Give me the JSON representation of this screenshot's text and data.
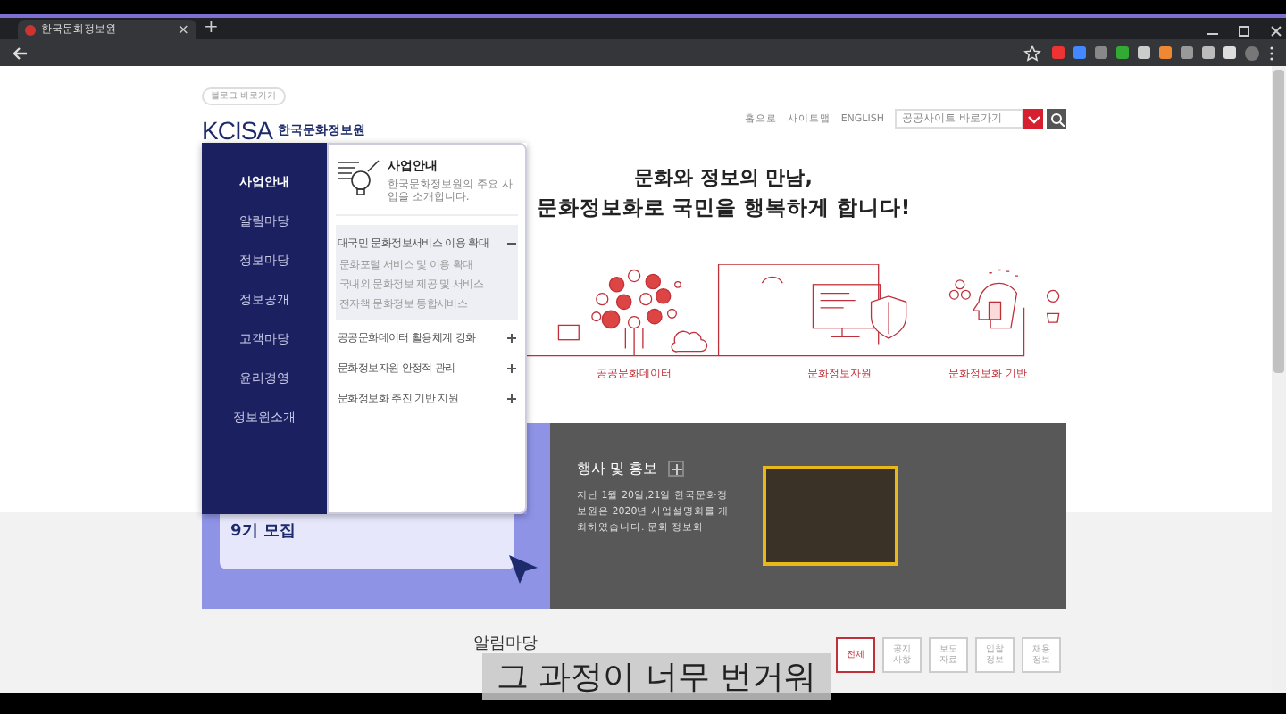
{
  "browser": {
    "tab_title": "한국문화정보원",
    "tab_close": "×",
    "new_tab": "+"
  },
  "header": {
    "quick_link": "블로그 바로가기",
    "logo": "KCISA",
    "logo_sub": "한국문화정보원",
    "util_links": [
      "홈으로",
      "사이트맵",
      "ENGLISH"
    ],
    "site_select": {
      "placeholder": "공공사이트 바로가기"
    }
  },
  "nav": {
    "items": [
      {
        "label": "사업안내",
        "selected": true
      },
      {
        "label": "알림마당",
        "selected": false
      },
      {
        "label": "정보마당",
        "selected": false
      },
      {
        "label": "정보공개",
        "selected": false
      },
      {
        "label": "고객마당",
        "selected": false
      },
      {
        "label": "윤리경영",
        "selected": false
      },
      {
        "label": "정보원소개",
        "selected": false
      }
    ]
  },
  "submenu": {
    "title": "사업안내",
    "description": "한국문화정보원의 주요 사업을 소개합니다.",
    "groups": [
      {
        "label": "대국민 문화정보서비스 이용 확대",
        "expanded": true,
        "children": [
          {
            "label": "문화포털 서비스 및 이용 확대"
          },
          {
            "label": "국내외 문화정보 제공 및 서비스"
          },
          {
            "label": "전자책 문화정보 통합서비스"
          }
        ]
      },
      {
        "label": "공공문화데이터 활용체계 강화",
        "expanded": false
      },
      {
        "label": "문화정보자원 안정적 관리",
        "expanded": false
      },
      {
        "label": "문화정보화 추진 기반 지원",
        "expanded": false
      }
    ]
  },
  "hero": {
    "headline": [
      "문화와 정보의 만남,",
      "문화정보화로 국민을 행복하게 합니다!"
    ],
    "labels": [
      "공공문화데이터",
      "문화정보자원",
      "문화정보화 기반"
    ]
  },
  "banner": {
    "recruit": "9기 모집"
  },
  "promo": {
    "title": "행사 및 홍보",
    "text": "지난 1월 20일,21일 한국문화정보원은 2020년 사업설명회를 개최하였습니다. 문화 정보화"
  },
  "notice": {
    "title": "알림마당",
    "tabs": [
      {
        "label": "전체",
        "selected": true
      },
      {
        "label": "공지 사항",
        "selected": false
      },
      {
        "label": "보도 자료",
        "selected": false
      },
      {
        "label": "입찰 정보",
        "selected": false
      },
      {
        "label": "채용 정보",
        "selected": false
      }
    ]
  },
  "subtitle": "그 과정이 너무 번거워"
}
